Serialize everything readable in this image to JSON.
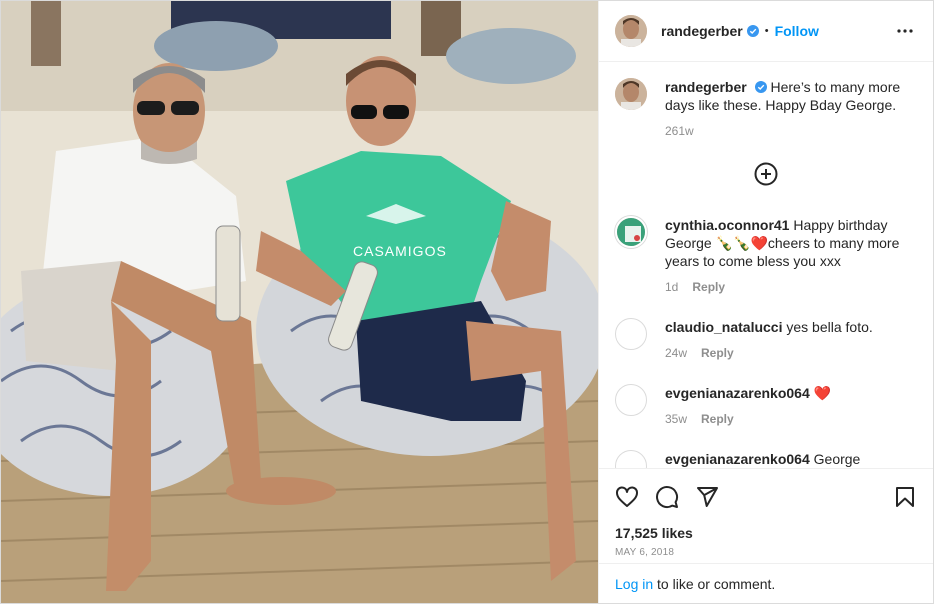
{
  "post": {
    "username": "randegerber",
    "follow_label": "Follow",
    "separator": "•",
    "caption": "Here’s to many more days like these. Happy Bday George.",
    "caption_age": "261w",
    "comments": [
      {
        "username": "cynthia.oconnor41",
        "text": "Happy birthday George 🍾🍾❤️cheers to many more years to come bless you xxx",
        "age": "1d",
        "reply": "Reply"
      },
      {
        "username": "claudio_natalucci",
        "text": "yes bella foto.",
        "age": "24w",
        "reply": "Reply"
      },
      {
        "username": "evgenianazarenko064",
        "text": "❤️",
        "age": "35w",
        "reply": "Reply"
      },
      {
        "username": "evgenianazarenko064",
        "text": "George",
        "age": "",
        "reply": ""
      }
    ],
    "likes": "17,525 likes",
    "date": "MAY 6, 2018",
    "login_link": "Log in",
    "login_rest": " to like or comment.",
    "photo_shirt_text": "CASAMIGOS",
    "icons": {
      "verified": "verified-badge-icon",
      "more": "more-options-icon",
      "load_more": "plus-circle-icon",
      "like": "heart-icon",
      "comment": "comment-icon",
      "share": "share-icon",
      "save": "bookmark-icon"
    },
    "colors": {
      "link": "#0095f6",
      "muted": "#8e8e8e",
      "text": "#262626",
      "border": "#dbdbdb"
    }
  }
}
